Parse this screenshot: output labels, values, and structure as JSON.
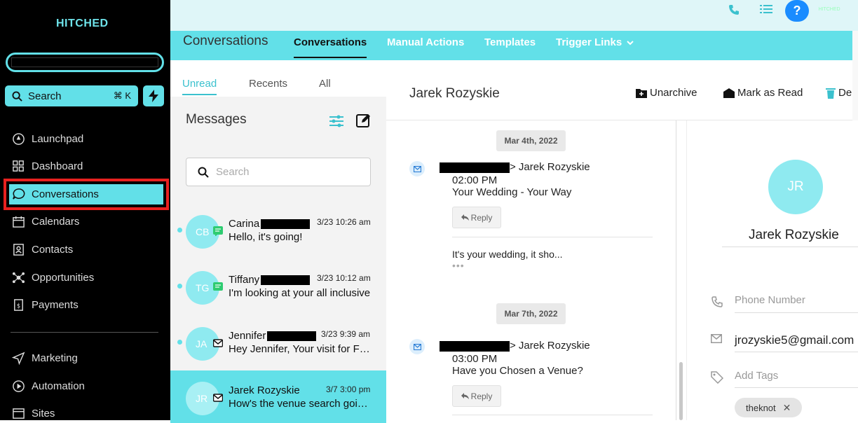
{
  "sidebar": {
    "logo": "HITCHED",
    "search_label": "Search",
    "search_shortcut": "⌘ K",
    "items": [
      {
        "label": "Launchpad",
        "icon": "rocket-icon"
      },
      {
        "label": "Dashboard",
        "icon": "grid-icon"
      },
      {
        "label": "Conversations",
        "icon": "chat-bubble-icon",
        "active": true
      },
      {
        "label": "Calendars",
        "icon": "calendar-icon"
      },
      {
        "label": "Contacts",
        "icon": "contact-card-icon"
      },
      {
        "label": "Opportunities",
        "icon": "network-icon"
      },
      {
        "label": "Payments",
        "icon": "receipt-icon"
      },
      {
        "label": "Marketing",
        "icon": "send-icon"
      },
      {
        "label": "Automation",
        "icon": "play-circle-icon"
      },
      {
        "label": "Sites",
        "icon": "globe-icon"
      }
    ]
  },
  "topbar": {
    "help": "?",
    "brand_badge": "HITCHED"
  },
  "header": {
    "title": "Conversations",
    "tabs": [
      {
        "label": "Conversations",
        "active": true
      },
      {
        "label": "Manual Actions"
      },
      {
        "label": "Templates"
      },
      {
        "label": "Trigger Links"
      }
    ]
  },
  "messages": {
    "filters": [
      "Unread",
      "Recents",
      "All"
    ],
    "active_filter": "Unread",
    "title": "Messages",
    "search_placeholder": "Search",
    "conversations": [
      {
        "initials": "CB",
        "name": "Carina",
        "time": "3/23 10:26 am",
        "preview": "Hello, it's going!",
        "channel": "sms",
        "unread": true
      },
      {
        "initials": "TG",
        "name": "Tiffany",
        "time": "3/23 10:12 am",
        "preview": "I'm looking at your all inclusive",
        "channel": "sms",
        "unread": true
      },
      {
        "initials": "JA",
        "name": "Jennifer",
        "time": "3/23 9:39 am",
        "preview": "Hey Jennifer, Your visit for F…",
        "channel": "email",
        "unread": true
      },
      {
        "initials": "JR",
        "name": "Jarek Rozyskie",
        "time": "3/7 3:00 pm",
        "preview": "How's the venue search goi…",
        "channel": "email",
        "unread": false,
        "selected": true
      }
    ]
  },
  "thread": {
    "contact_name": "Jarek Rozyskie",
    "actions": [
      "Unarchive",
      "Mark as Read",
      "Del"
    ],
    "entries": [
      {
        "date": "Mar 4th, 2022",
        "to": "> Jarek Rozyskie",
        "time": "02:00 PM",
        "subject": "Your Wedding - Your Way",
        "reply": "Reply",
        "snippet": "It's your wedding, it sho...",
        "more": "•••"
      },
      {
        "date": "Mar 7th, 2022",
        "to": "> Jarek Rozyskie",
        "time": "03:00 PM",
        "subject": "Have you Chosen a Venue?",
        "reply": "Reply"
      }
    ]
  },
  "contact": {
    "initials": "JR",
    "name": "Jarek Rozyskie",
    "phone_placeholder": "Phone Number",
    "email": "jrozyskie5@gmail.com",
    "tags_placeholder": "Add Tags",
    "tags": [
      "theknot"
    ]
  },
  "colors": {
    "accent": "#62e0e8",
    "sidebar_bg": "#000000",
    "highlight_outline": "#e8211f",
    "help_button": "#1a8cff"
  }
}
